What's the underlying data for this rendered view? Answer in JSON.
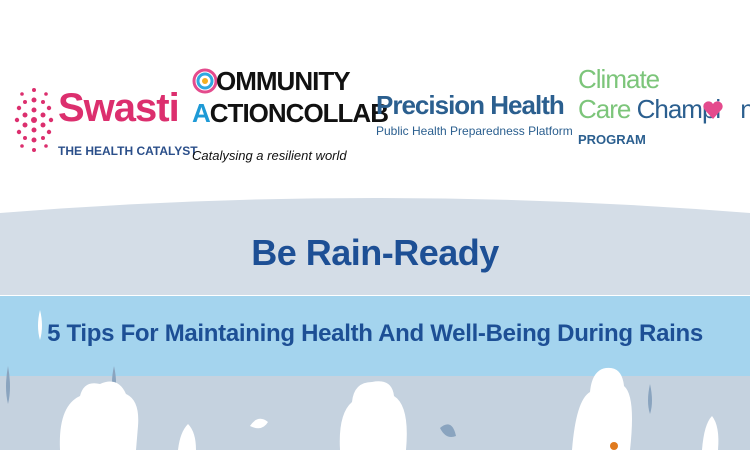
{
  "logos": {
    "swasti": {
      "name": "Swasti",
      "tagline": "THE HEALTH CATALYST",
      "color": "#dc2f6e"
    },
    "community_action_collab": {
      "line1": "OMMUNITY",
      "line2": "CTIONCOLLAB",
      "tagline": "Catalysing a resilient world",
      "letter_a": "A"
    },
    "precision_health": {
      "name": "Precision Health",
      "tagline": "Public Health Preparedness Platform",
      "color": "#2b5f8f"
    },
    "climate_care_champions": {
      "line1": "Climate",
      "care": "Care",
      "champions": "Champi",
      "champions_end": "ns",
      "program": "PROGRAM"
    }
  },
  "banner": {
    "title": "Be Rain-Ready",
    "subtitle": "5 Tips For Maintaining Health And Well-Being During Rains",
    "title_color": "#1d4f95",
    "band_color": "#a4d4ee"
  }
}
